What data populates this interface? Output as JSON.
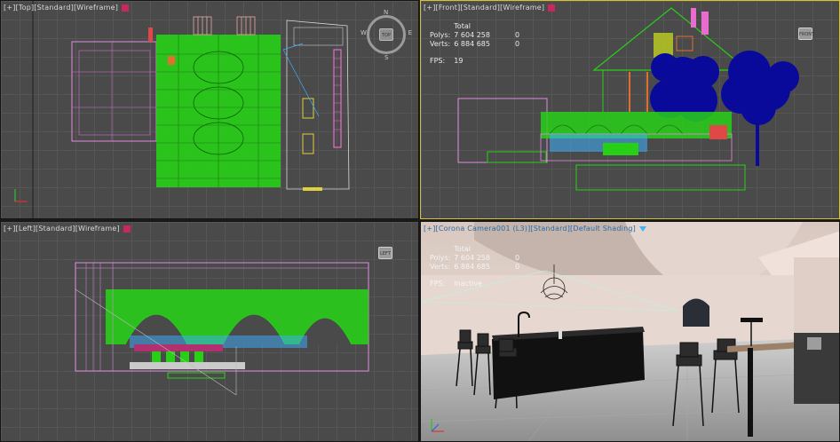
{
  "viewports": {
    "top": {
      "label_parts": [
        "[+]",
        "[Top]",
        "[Standard]",
        "[Wireframe]"
      ],
      "viewcube_label": "TOP",
      "compass": {
        "n": "N",
        "s": "S",
        "e": "E",
        "w": "W"
      }
    },
    "front": {
      "label_parts": [
        "[+]",
        "[Front]",
        "[Standard]",
        "[Wireframe]"
      ],
      "viewcube_label": "FRONT",
      "stats": {
        "header": "Total",
        "polys_label": "Polys:",
        "polys_value": "7 604 258",
        "polys_sel": "0",
        "verts_label": "Verts:",
        "verts_value": "6 884 685",
        "verts_sel": "0",
        "fps_label": "FPS:",
        "fps_value": "19"
      }
    },
    "left": {
      "label_parts": [
        "[+]",
        "[Left]",
        "[Standard]",
        "[Wireframe]"
      ],
      "viewcube_label": "LEFT"
    },
    "camera": {
      "label_parts": [
        "[+]",
        "[Corona Camera001 (L3)]",
        "[Standard]",
        "[Default Shading]"
      ],
      "stats": {
        "header": "Total",
        "polys_label": "Polys:",
        "polys_value": "7 604 258",
        "polys_sel": "0",
        "verts_label": "Verts:",
        "verts_value": "6 884 685",
        "verts_sel": "0",
        "fps_label": "FPS:",
        "fps_value": "Inactive"
      }
    }
  },
  "colors": {
    "viewport_bg": "#4a4a4a",
    "active_border": "#d9c32a",
    "wire_green": "#27d017",
    "wire_pink": "#e08ae0",
    "tree_blue": "#0a0a9a",
    "badge_magenta": "#c8285a"
  }
}
